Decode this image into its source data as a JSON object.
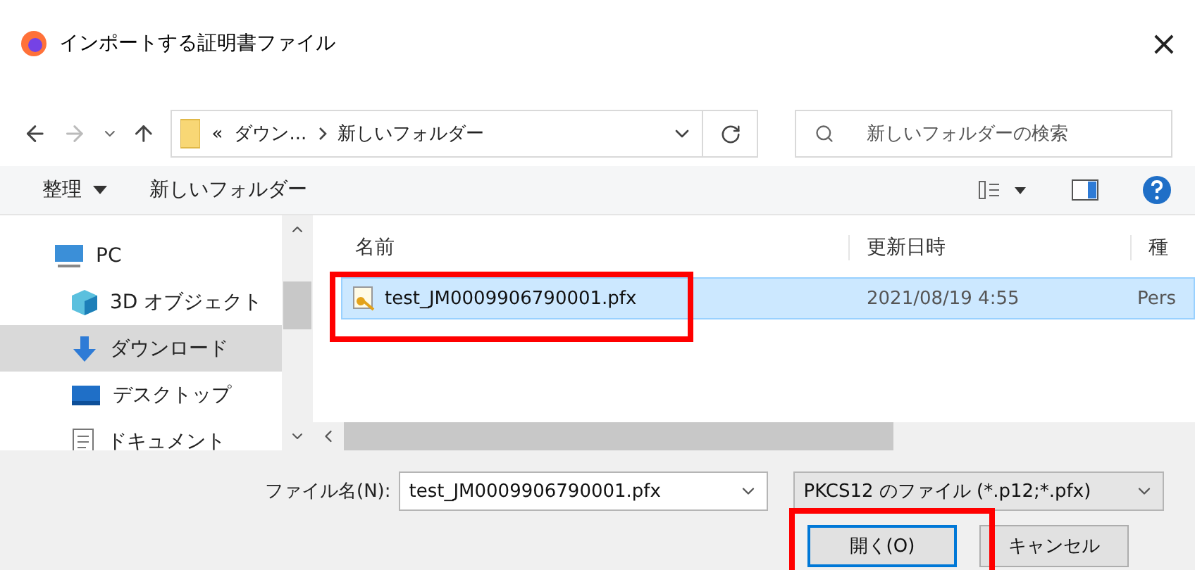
{
  "window": {
    "title": "インポートする証明書ファイル",
    "close": "×"
  },
  "address": {
    "overflow": "«",
    "crumbs": [
      "ダウン...",
      "新しいフォルダー"
    ],
    "search_placeholder": "新しいフォルダーの検索"
  },
  "toolbar": {
    "organize": "整理",
    "new_folder": "新しいフォルダー"
  },
  "sidebar": {
    "items": [
      {
        "label": "PC",
        "kind": "monitor",
        "selected": false,
        "children": [
          {
            "label": "3D オブジェクト",
            "kind": "cube",
            "selected": false
          },
          {
            "label": "ダウンロード",
            "kind": "download",
            "selected": true
          },
          {
            "label": "デスクトップ",
            "kind": "desktop",
            "selected": false
          },
          {
            "label": "ドキュメント",
            "kind": "document",
            "selected": false
          }
        ]
      }
    ]
  },
  "table": {
    "columns": [
      "名前",
      "更新日時",
      "種"
    ],
    "rows": [
      {
        "name": "test_JM0009906790001.pfx",
        "modified": "2021/08/19 4:55",
        "type": "Pers",
        "selected": true,
        "highlighted": true
      }
    ]
  },
  "footer": {
    "filename_label": "ファイル名(N):",
    "filename": "test_JM0009906790001.pfx",
    "filter": "PKCS12 のファイル (*.p12;*.pfx)",
    "buttons": [
      {
        "label": "開く(O)",
        "default": true,
        "highlighted": true
      },
      {
        "label": "キャンセル",
        "default": false,
        "highlighted": false
      }
    ]
  }
}
